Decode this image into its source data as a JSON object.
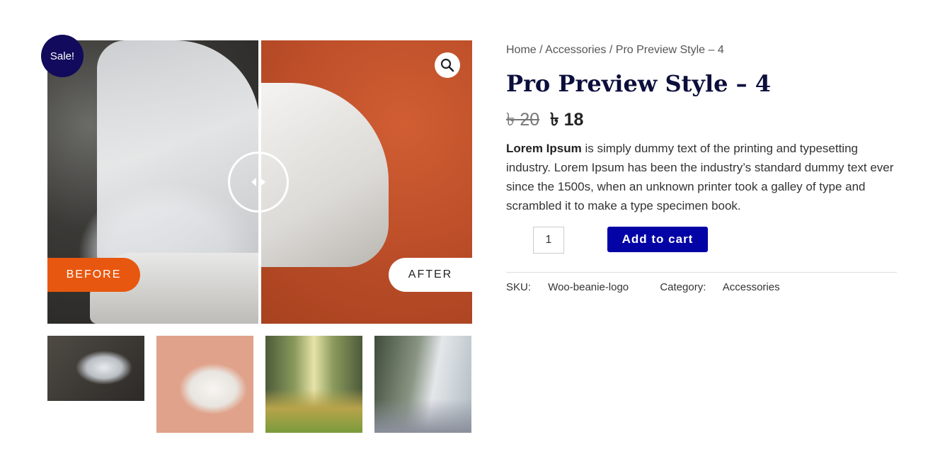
{
  "badge": {
    "sale": "Sale!"
  },
  "gallery": {
    "before_label": "BEFORE",
    "after_label": "AFTER",
    "zoom_icon": "magnifier-icon",
    "slider_position": 0.5
  },
  "breadcrumb": {
    "home": "Home",
    "category": "Accessories",
    "current": "Pro Preview Style – 4",
    "separator": "/"
  },
  "product": {
    "title": "Pro Preview Style – 4",
    "price_old": "৳ 20",
    "price_new": "৳ 18",
    "desc_bold": "Lorem Ipsum",
    "desc_rest": " is simply dummy text of the printing and typesetting industry. Lorem Ipsum has been the industry’s standard dummy text ever since the 1500s, when an unknown printer took a galley of type and scrambled it to make a type specimen book.",
    "quantity": "1",
    "add_to_cart": "Add to cart",
    "sku_label": "SKU:",
    "sku_value": "Woo-beanie-logo",
    "category_label": "Category:",
    "category_value": "Accessories"
  },
  "colors": {
    "accent": "#0303a6",
    "sale": "#120a5c",
    "before": "#e8570f",
    "title": "#0c0e3c"
  }
}
